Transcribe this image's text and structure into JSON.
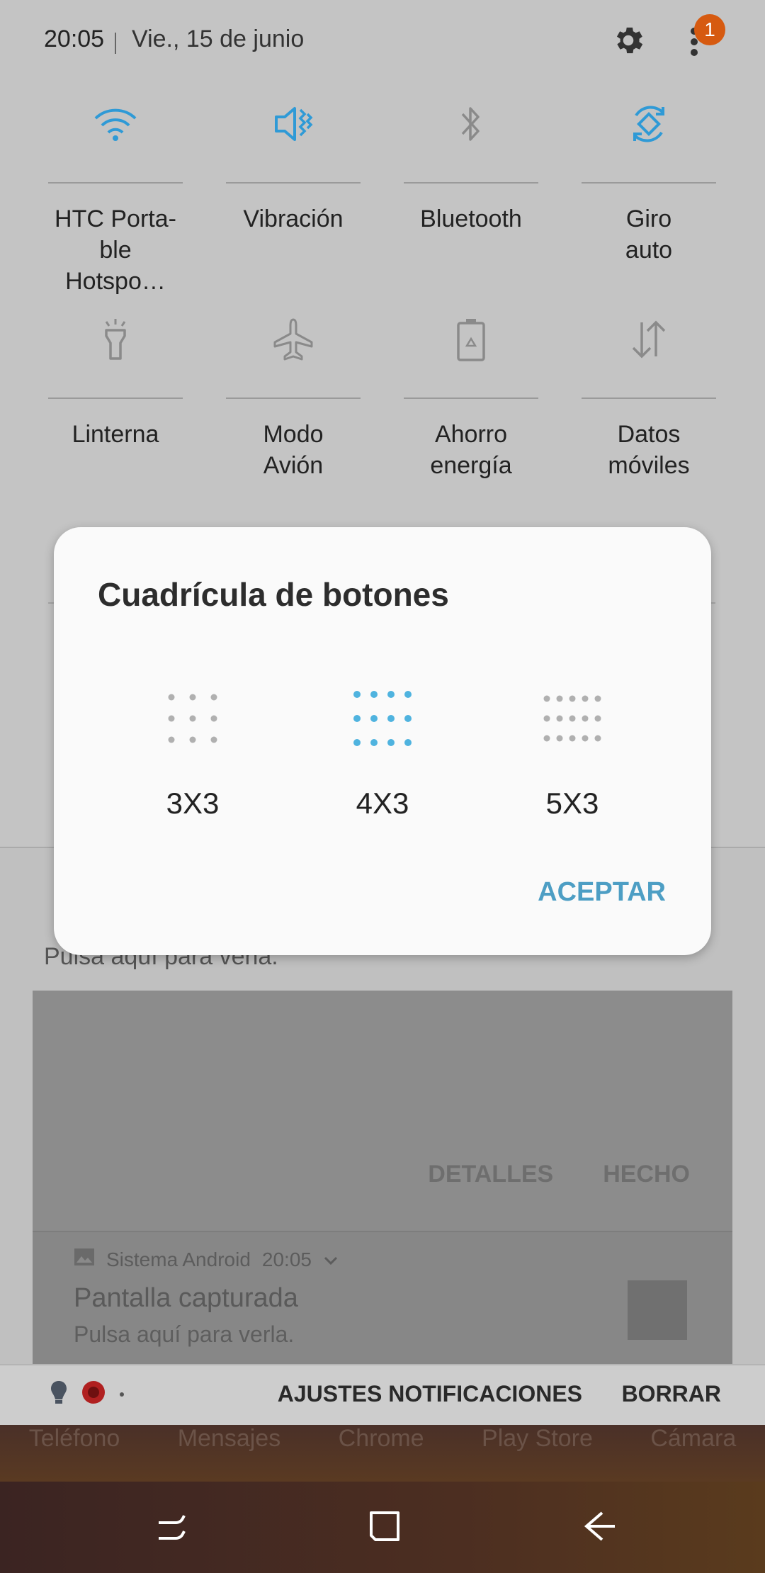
{
  "status": {
    "time": "20:05",
    "date": "Vie., 15 de junio",
    "badge_count": "1"
  },
  "tiles": [
    {
      "label": "HTC Porta-\nble Hotspo…",
      "label1": "HTC Porta-",
      "label2": "ble Hotspo…",
      "icon": "wifi-icon",
      "active": true
    },
    {
      "label1": "Vibración",
      "label2": "",
      "icon": "vibrate-icon",
      "active": true
    },
    {
      "label1": "Bluetooth",
      "label2": "",
      "icon": "bluetooth-icon",
      "active": false
    },
    {
      "label1": "Giro",
      "label2": "auto",
      "icon": "auto-rotate-icon",
      "active": true
    },
    {
      "label1": "Linterna",
      "label2": "",
      "icon": "flashlight-icon",
      "active": false
    },
    {
      "label1": "Modo",
      "label2": "Avión",
      "icon": "airplane-icon",
      "active": false
    },
    {
      "label1": "Ahorro",
      "label2": "energía",
      "icon": "battery-saver-icon",
      "active": false
    },
    {
      "label1": "Datos",
      "label2": "móviles",
      "icon": "mobile-data-icon",
      "active": false
    }
  ],
  "colors": {
    "accent": "#2f9ad6",
    "inactive_icon": "#8a8a8a",
    "dialog_accent": "#4d9ec4"
  },
  "dialog": {
    "title": "Cuadrícula de botones",
    "options": [
      {
        "label": "3X3",
        "selected": false
      },
      {
        "label": "4X3",
        "selected": true
      },
      {
        "label": "5X3",
        "selected": false
      }
    ],
    "accept": "ACEPTAR"
  },
  "notifications": {
    "first_sub": "Pulsa aquí para verla.",
    "actions": [
      "DETALLES",
      "HECHO"
    ],
    "second": {
      "app": "Sistema Android",
      "time": "20:05",
      "title": "Pantalla capturada",
      "sub": "Pulsa aquí para verla."
    }
  },
  "notif_bar": {
    "settings": "AJUSTES NOTIFICACIONES",
    "clear": "BORRAR"
  },
  "dock": [
    "Teléfono",
    "Mensajes",
    "Chrome",
    "Play Store",
    "Cámara"
  ]
}
